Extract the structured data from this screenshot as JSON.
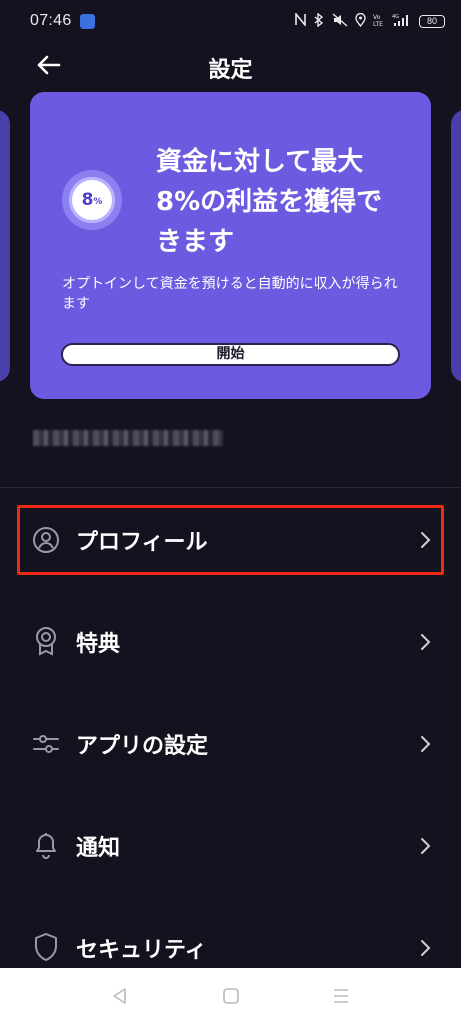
{
  "status_bar": {
    "time": "07:46",
    "battery": "80",
    "icons": [
      "nfc-icon",
      "bluetooth-icon",
      "mute-icon",
      "location-icon",
      "volte-icon",
      "signal-4g-icon",
      "battery-icon"
    ],
    "network_label": "4G"
  },
  "header": {
    "title": "設定"
  },
  "promo": {
    "badge_number": "8",
    "badge_unit": "%",
    "headline": "資金に対して最大8%の利益を獲得できます",
    "body": "オプトインして資金を預けると自動的に収入が得られます",
    "button_label": "開始",
    "background_color": "#6c5ae0"
  },
  "menu": {
    "items": [
      {
        "label": "プロフィール",
        "icon": "profile-icon"
      },
      {
        "label": "特典",
        "icon": "award-icon"
      },
      {
        "label": "アプリの設定",
        "icon": "sliders-icon"
      },
      {
        "label": "通知",
        "icon": "bell-icon"
      },
      {
        "label": "セキュリティ",
        "icon": "shield-icon"
      }
    ],
    "highlight_color": "#ee2a16"
  },
  "nav_bar": {
    "buttons": [
      "back-triangle-icon",
      "home-square-icon",
      "recents-lines-icon"
    ]
  }
}
